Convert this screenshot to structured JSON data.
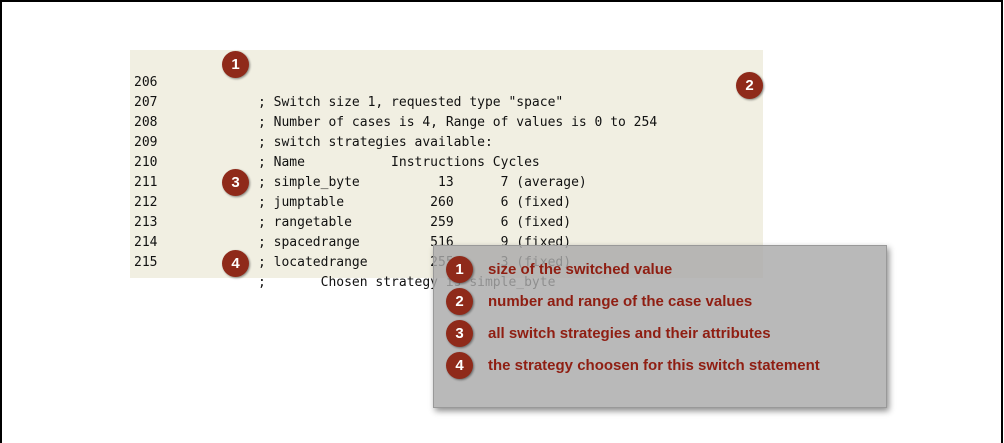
{
  "listing": {
    "lines": [
      {
        "num": "206",
        "code": "; Switch size 1, requested type \"space\""
      },
      {
        "num": "207",
        "code": "; Number of cases is 4, Range of values is 0 to 254"
      },
      {
        "num": "208",
        "code": "; switch strategies available:"
      },
      {
        "num": "209",
        "code": "; Name           Instructions Cycles"
      },
      {
        "num": "210",
        "code": "; simple_byte          13      7 (average)"
      },
      {
        "num": "211",
        "code": "; jumptable           260      6 (fixed)"
      },
      {
        "num": "212",
        "code": "; rangetable          259      6 (fixed)"
      },
      {
        "num": "213",
        "code": "; spacedrange         516      9 (fixed)"
      },
      {
        "num": "214",
        "code": "; locatedrange        255      3 (fixed)"
      },
      {
        "num": "215",
        "code": ";       Chosen strategy is simple_byte"
      }
    ]
  },
  "badges": [
    "1",
    "2",
    "3",
    "4"
  ],
  "legend": {
    "items": [
      {
        "num": "1",
        "text": "size of the switched value"
      },
      {
        "num": "2",
        "text": "number and range of the case values"
      },
      {
        "num": "3",
        "text": "all switch strategies and their attributes"
      },
      {
        "num": "4",
        "text": "the strategy choosen for this switch statement"
      }
    ]
  },
  "colors": {
    "badge": "#8f2a1a",
    "legend_text": "#8f1e12",
    "listing_bg": "#f1efe2",
    "legend_bg": "#aaaaaa"
  }
}
